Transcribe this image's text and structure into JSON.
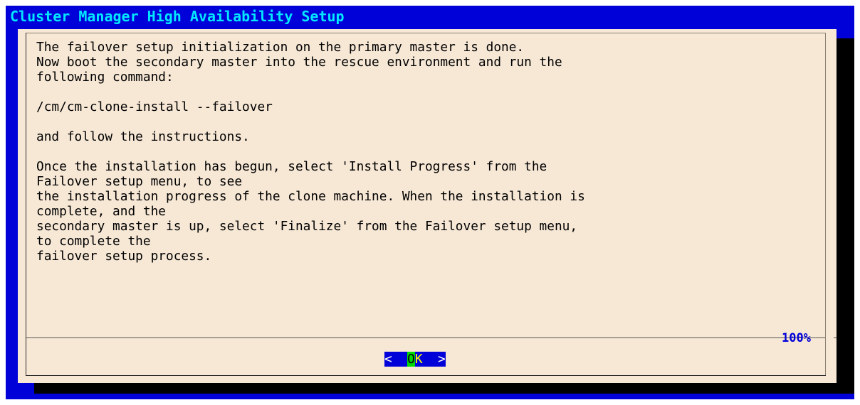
{
  "app": {
    "backtitle": "Cluster Manager High Availability Setup"
  },
  "dialog": {
    "message_lines": [
      "The failover setup initialization on the primary master is done.",
      "Now boot the secondary master into the rescue environment and run the",
      "following command:",
      "",
      "/cm/cm-clone-install --failover",
      "",
      "and follow the instructions.",
      "",
      "Once the installation has begun, select 'Install Progress' from the",
      "Failover setup menu, to see",
      "the installation progress of the clone machine. When the installation is",
      "complete, and the",
      "secondary master is up, select 'Finalize' from the Failover setup menu,",
      "to complete the",
      "failover setup process."
    ],
    "scroll_percent": "100%",
    "ok_button": {
      "left_bracket": "<",
      "hotkey": "O",
      "rest": "K",
      "right_bracket": ">"
    }
  },
  "colors": {
    "screen_background": "#0000d8",
    "title_text": "#00e8ff",
    "dialog_background": "#f7e8d6",
    "button_hotkey": "#00d800",
    "button_text": "#ffff00"
  }
}
